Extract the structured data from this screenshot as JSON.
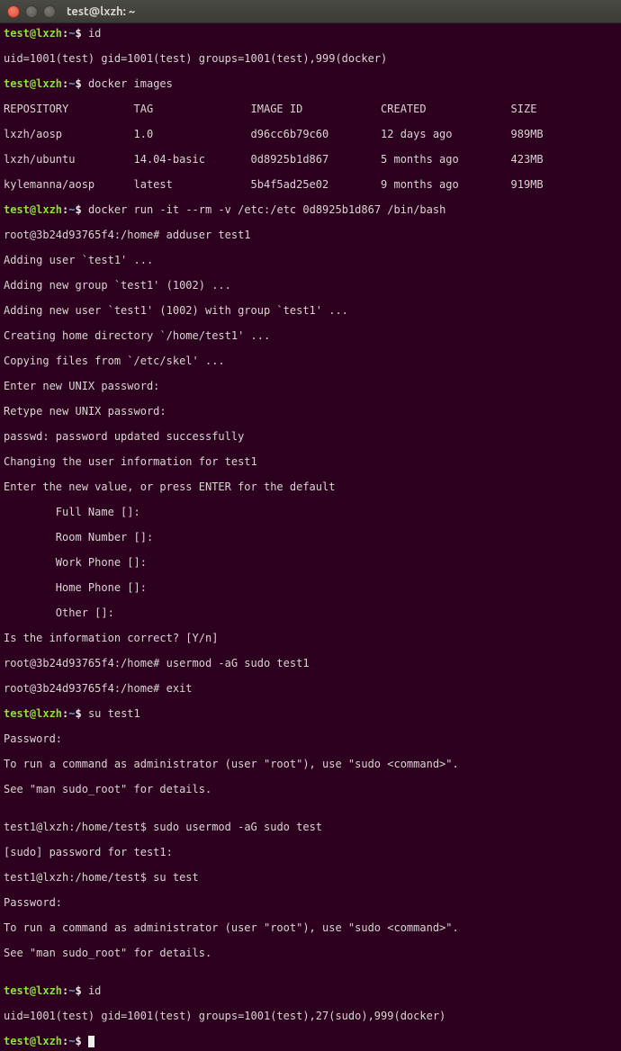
{
  "window": {
    "title": "test@lxzh: ~"
  },
  "colors": {
    "bg": "#2c001e",
    "green": "#8ae234",
    "white": "#eeeeec",
    "blue": "#729fcf"
  },
  "prompt": {
    "user_host": "test@lxzh",
    "path": "~",
    "sep": ":",
    "dollar": "$"
  },
  "prompt2": {
    "prefix": "test1@lxzh:/home/test$"
  },
  "rootprompt": {
    "text": "root@3b24d93765f4:/home#"
  },
  "cmds": {
    "id1": " id",
    "id1_out": "uid=1001(test) gid=1001(test) groups=1001(test),999(docker)",
    "dimg": " docker images",
    "drun": " docker run -it --rm -v /etc:/etc 0d8925b1d867 /bin/bash",
    "adduser": " adduser test1",
    "usermod1": " usermod -aG sudo test1",
    "exit": " exit",
    "su1": " su test1",
    "su2": " su test",
    "sudo_usermod": " sudo usermod -aG sudo test",
    "id2": " id",
    "id2_out": "uid=1001(test) gid=1001(test) groups=1001(test),27(sudo),999(docker)"
  },
  "table": {
    "header": {
      "c1": "REPOSITORY",
      "c2": "TAG",
      "c3": "IMAGE ID",
      "c4": "CREATED",
      "c5": "SIZE"
    },
    "rows": [
      {
        "c1": "lxzh/aosp",
        "c2": "1.0",
        "c3": "d96cc6b79c60",
        "c4": "12 days ago",
        "c5": "989MB"
      },
      {
        "c1": "lxzh/ubuntu",
        "c2": "14.04-basic",
        "c3": "0d8925b1d867",
        "c4": "5 months ago",
        "c5": "423MB"
      },
      {
        "c1": "kylemanna/aosp",
        "c2": "latest",
        "c3": "5b4f5ad25e02",
        "c4": "9 months ago",
        "c5": "919MB"
      }
    ]
  },
  "adduser_out": {
    "l1": "Adding user `test1' ...",
    "l2": "Adding new group `test1' (1002) ...",
    "l3": "Adding new user `test1' (1002) with group `test1' ...",
    "l4": "Creating home directory `/home/test1' ...",
    "l5": "Copying files from `/etc/skel' ...",
    "l6": "Enter new UNIX password:",
    "l7": "Retype new UNIX password:",
    "l8": "passwd: password updated successfully",
    "l9": "Changing the user information for test1",
    "l10": "Enter the new value, or press ENTER for the default",
    "l11": "        Full Name []:",
    "l12": "        Room Number []:",
    "l13": "        Work Phone []:",
    "l14": "        Home Phone []:",
    "l15": "        Other []:",
    "l16": "Is the information correct? [Y/n]"
  },
  "su_out": {
    "pw": "Password:",
    "l1": "To run a command as administrator (user \"root\"), use \"sudo <command>\".",
    "l2": "See \"man sudo_root\" for details.",
    "blank": ""
  },
  "sudo_out": {
    "l1": "[sudo] password for test1:"
  }
}
